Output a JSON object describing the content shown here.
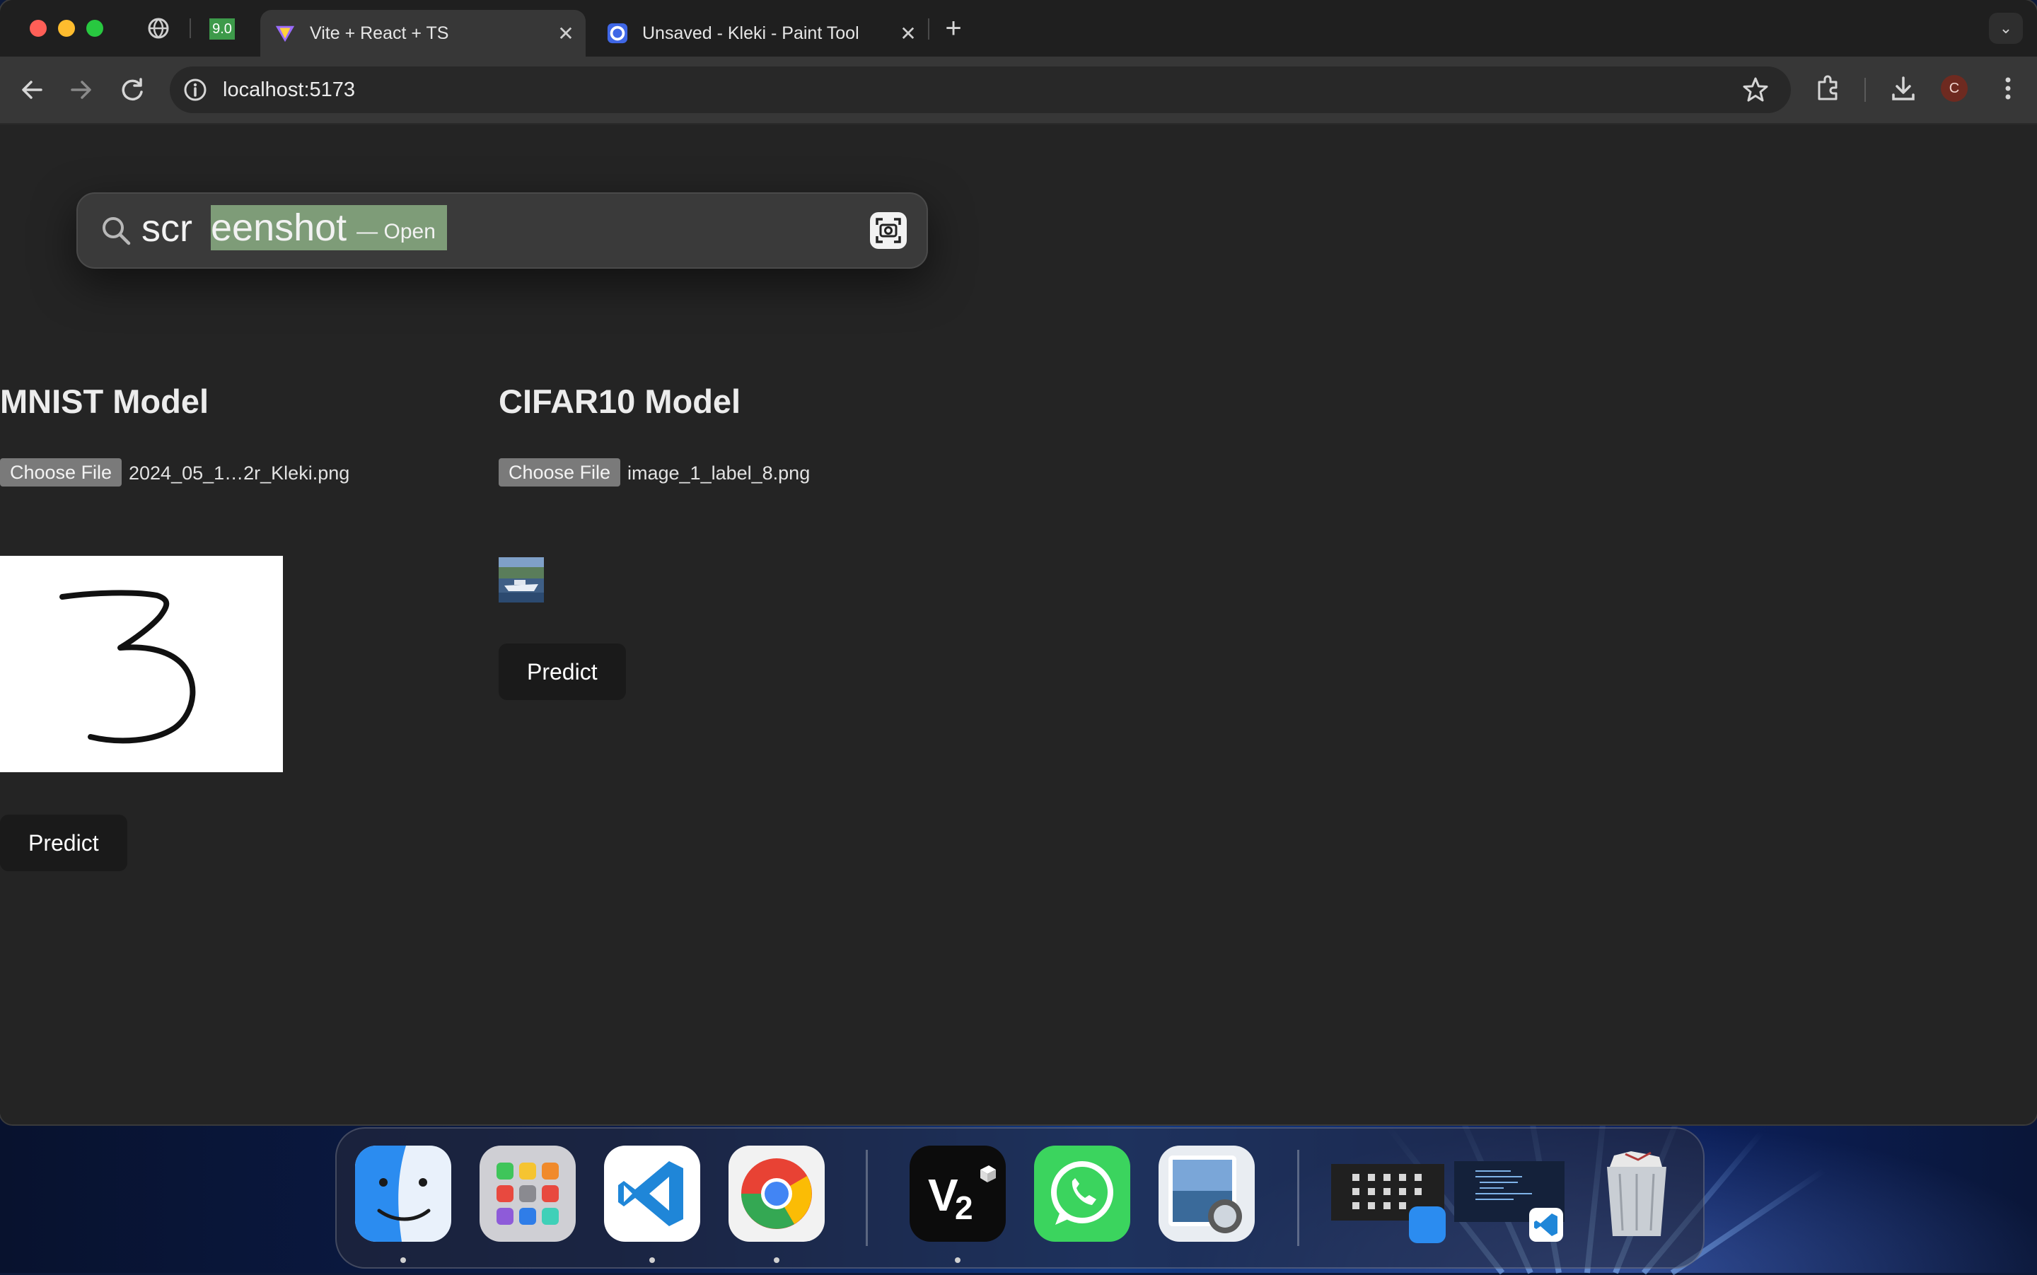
{
  "browser": {
    "tabs": [
      {
        "title": "Vite + React + TS",
        "active": true
      },
      {
        "title": "Unsaved - Kleki - Paint Tool",
        "active": false
      }
    ],
    "pinned_tab_badge": "9.0",
    "address": "localhost:5173",
    "profile_initial": "C"
  },
  "spotlight": {
    "typed_prefix": "scr",
    "completion": "eenshot",
    "action": "— Open"
  },
  "mnist": {
    "title": "MNIST Model",
    "choose_label": "Choose File",
    "file_name": "2024_05_1…2r_Kleki.png",
    "predict_label": "Predict"
  },
  "cifar": {
    "title": "CIFAR10 Model",
    "choose_label": "Choose File",
    "file_name": "image_1_label_8.png",
    "predict_label": "Predict"
  },
  "dock": {
    "apps": [
      "finder-icon",
      "launchpad-icon",
      "vscode-icon",
      "chrome-icon",
      "v2-icon",
      "whatsapp-icon",
      "preview-icon",
      "finder-window-thumbnail",
      "vscode-window-thumbnail",
      "trash-icon"
    ]
  },
  "colors": {
    "page_bg": "#242424",
    "button_bg": "#1a1a1a",
    "spotlight_selection": "#7e9c78"
  }
}
